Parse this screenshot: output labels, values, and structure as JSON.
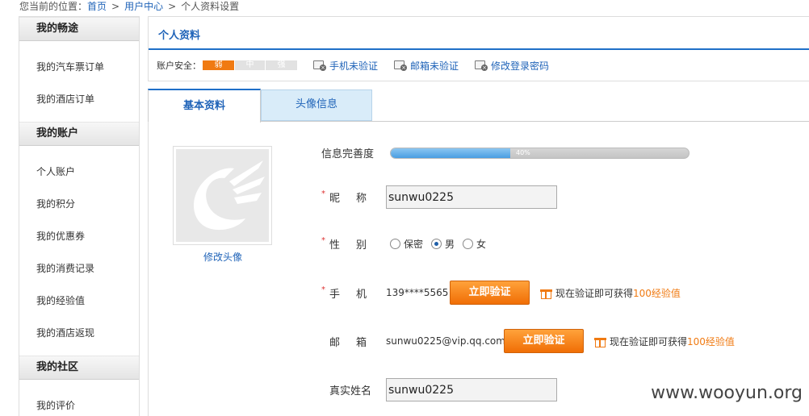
{
  "breadcrumb": {
    "prefix": "您当前的位置：",
    "home": "首页",
    "sep": ">",
    "user_center": "用户中心",
    "current": "个人资料设置"
  },
  "sidebar": {
    "sections": [
      {
        "title": "我的畅途",
        "items": [
          "我的汽车票订单",
          "我的酒店订单"
        ]
      },
      {
        "title": "我的账户",
        "items": [
          "个人账户",
          "我的积分",
          "我的优惠券",
          "我的消费记录",
          "我的经验值",
          "我的酒店返现"
        ]
      },
      {
        "title": "我的社区",
        "items": [
          "我的评价"
        ]
      }
    ]
  },
  "profile": {
    "title": "个人资料",
    "security_label": "账户安全：",
    "strength": [
      "弱",
      "中",
      "强"
    ],
    "links": {
      "phone": "手机未验证",
      "email": "邮箱未验证",
      "password": "修改登录密码"
    }
  },
  "tabs": {
    "basic": "基本资料",
    "avatar": "头像信息"
  },
  "avatar": {
    "edit_label": "修改头像"
  },
  "form": {
    "completeness_label": "信息完善度",
    "completeness_value": 0.4,
    "completeness_text": "40%",
    "nickname_label": "昵称",
    "nickname_value": "sunwu0225",
    "gender_label": "性别",
    "gender_options": [
      "保密",
      "男",
      "女"
    ],
    "gender_selected": "男",
    "phone_label": "手机",
    "phone_value": "139****5565",
    "email_label": "邮箱",
    "email_value": "sunwu0225@vip.qq.com",
    "verify_button": "立即验证",
    "reward_prefix": "现在验证即可获得",
    "reward_highlight": "100经验值",
    "realname_label": "真实姓名",
    "realname_value": "sunwu0225",
    "required_mark": "*"
  },
  "watermark": "www.wooyun.org",
  "colors": {
    "accent": "#1f63b8",
    "orange": "#f07a12",
    "progress": "#4a9ee2"
  }
}
